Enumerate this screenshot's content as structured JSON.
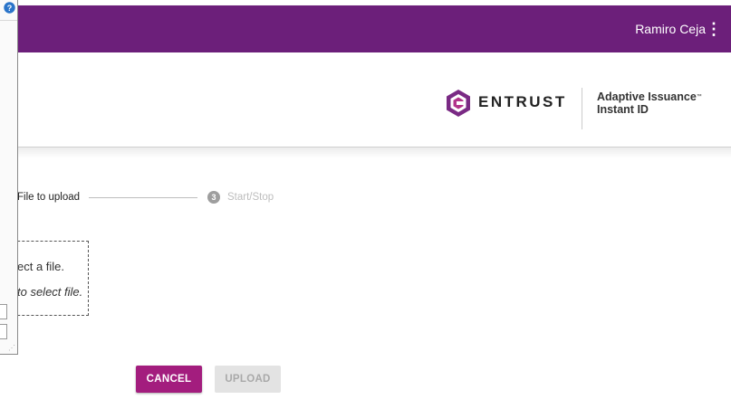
{
  "header": {
    "user_name": "Ramiro Ceja",
    "menu_icon": "vertical-dots-icon",
    "brand_name": "ENTRUST",
    "product_line1": "Adaptive Issuance",
    "product_tm": "™",
    "product_line2": "Instant ID",
    "colors": {
      "topbar": "#6c1f7a",
      "accent": "#a31d7e"
    }
  },
  "stepper": {
    "active_step_label": "File to upload",
    "next_step_number": "3",
    "next_step_label": "Start/Stop"
  },
  "dropzone": {
    "line1": "ect a file.",
    "line2": "to select file."
  },
  "side_panel": {
    "help_icon": "help-circle-icon"
  },
  "actions": {
    "cancel_label": "CANCEL",
    "upload_label": "UPLOAD"
  }
}
